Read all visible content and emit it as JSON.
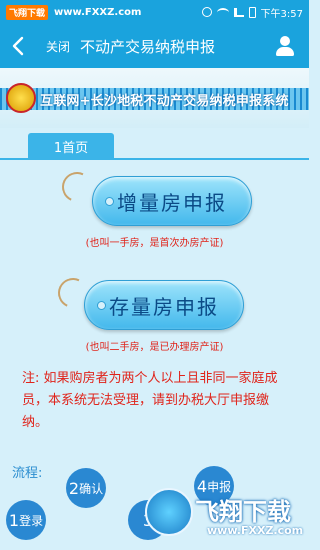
{
  "status_bar": {
    "watermark_badge": "飞翔下载",
    "watermark_site": "www.FXXZ.com",
    "time": "下午3:57",
    "icons": [
      "alarm-icon",
      "wifi-icon",
      "signal-icon",
      "battery-icon"
    ]
  },
  "app_bar": {
    "back_icon": "chevron-left-icon",
    "close_label": "关闭",
    "title": "不动产交易纳税申报",
    "user_icon": "user-icon"
  },
  "banner": {
    "title": "互联网+长沙地税不动产交易纳税申报系统"
  },
  "page_tab": {
    "label": "1首页"
  },
  "buttons": {
    "new_house_label": "增量房申报",
    "new_house_note": "(也叫一手房，是首次办房产证)",
    "existing_house_label": "存量房申报",
    "existing_house_note": "(也叫二手房，是已办理房产证)"
  },
  "notice": {
    "text": "注: 如果购房者为两个人以上且非同一家庭成 员，本系统无法受理，请到办税大厅申报缴纳。"
  },
  "flow": {
    "label": "流程:",
    "steps": [
      {
        "num": "1",
        "label": "登录"
      },
      {
        "num": "2",
        "label": "确认"
      },
      {
        "num": "3",
        "label": ""
      },
      {
        "num": "4",
        "label": "申报"
      }
    ]
  },
  "watermark_logo": {
    "main": "飞翔下载",
    "sub": "www.FXXZ.com"
  },
  "colors": {
    "primary": "#1aa3dd",
    "background": "#d6f0fa",
    "button": "#43b8ec",
    "note_red": "#e0241b",
    "step_blue": "#2a88d2"
  }
}
